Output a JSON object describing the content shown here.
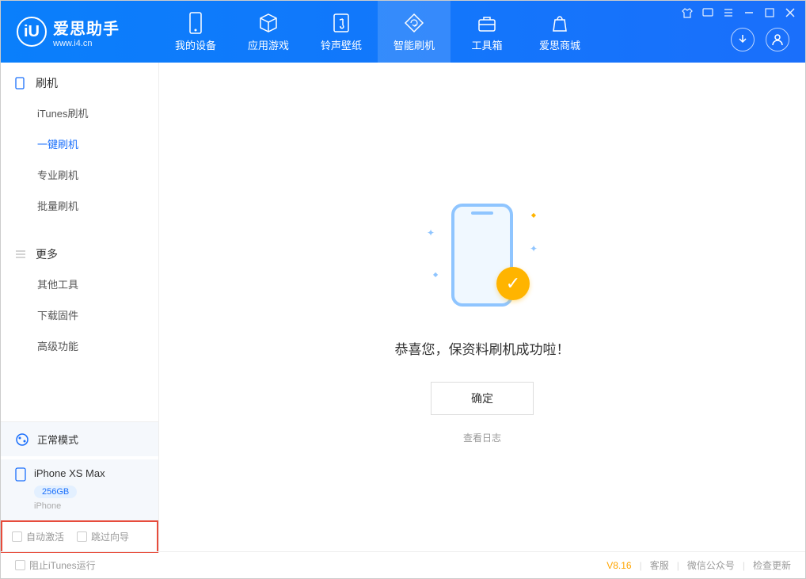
{
  "logo": {
    "title": "爱思助手",
    "subtitle": "www.i4.cn",
    "icon_letter": "iU"
  },
  "nav": [
    {
      "label": "我的设备",
      "icon": "device"
    },
    {
      "label": "应用游戏",
      "icon": "cube"
    },
    {
      "label": "铃声壁纸",
      "icon": "music"
    },
    {
      "label": "智能刷机",
      "icon": "refresh",
      "active": true
    },
    {
      "label": "工具箱",
      "icon": "toolbox"
    },
    {
      "label": "爱思商城",
      "icon": "store"
    }
  ],
  "sidebar": {
    "section1": {
      "title": "刷机",
      "items": [
        "iTunes刷机",
        "一键刷机",
        "专业刷机",
        "批量刷机"
      ],
      "active_index": 1
    },
    "section2": {
      "title": "更多",
      "items": [
        "其他工具",
        "下载固件",
        "高级功能"
      ]
    }
  },
  "device": {
    "mode": "正常模式",
    "name": "iPhone XS Max",
    "storage": "256GB",
    "type": "iPhone"
  },
  "checkboxes": {
    "auto_activate": "自动激活",
    "skip_guide": "跳过向导"
  },
  "content": {
    "success_message": "恭喜您，保资料刷机成功啦！",
    "ok_button": "确定",
    "view_log": "查看日志"
  },
  "footer": {
    "block_itunes": "阻止iTunes运行",
    "version": "V8.16",
    "links": [
      "客服",
      "微信公众号",
      "检查更新"
    ]
  }
}
